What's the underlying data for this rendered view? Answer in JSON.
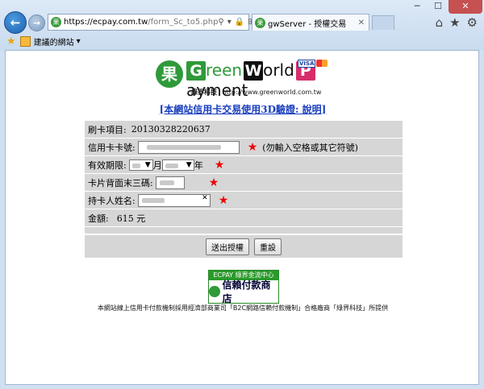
{
  "browser": {
    "url_host": "https://ecpay.com.tw",
    "url_path": "/form_Sc_to5.php",
    "tab_title": "gwServer - 授權交易",
    "favorites_label": "建議的網站"
  },
  "logo": {
    "brand_chars": [
      "G",
      "reen",
      "W",
      "orld",
      "P",
      "ayment"
    ],
    "tagline_cn": "綠界科技",
    "tagline_url": "http://www.greenworld.com.tw",
    "visa": "VISA",
    "colors": {
      "green": "#2f9a3a",
      "black": "#111111",
      "pink": "#d62e6b"
    }
  },
  "link_3d": "[本網站信用卡交易使用3D驗證: 說明]",
  "form": {
    "item_label": "刷卡項目:",
    "item_value": "20130328220637",
    "card_label": "信用卡卡號:",
    "card_hint": "(勿輸入空格或其它符號)",
    "expiry_label": "有效期限:",
    "month_unit": "月",
    "year_unit": "年",
    "cvv_label": "卡片背面末三碼:",
    "holder_label": "持卡人姓名:",
    "amount_label": "金額:",
    "amount_value": "615 元",
    "submit_label": "送出授權",
    "reset_label": "重設"
  },
  "badge": {
    "top": "ECPAY 綠界金流中心",
    "bottom": "信賴付款商店"
  },
  "footer": "本網站線上信用卡付款機制採用經濟部商業司「B2C網路信賴付款機制」合格廠商「綠界科技」所提供"
}
